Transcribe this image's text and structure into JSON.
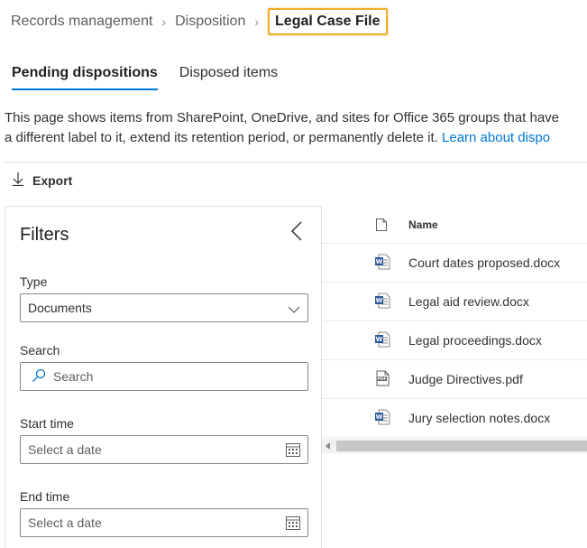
{
  "breadcrumb": {
    "items": [
      "Records management",
      "Disposition"
    ],
    "current": "Legal Case File"
  },
  "tabs": {
    "pending": "Pending dispositions",
    "disposed": "Disposed items"
  },
  "description": {
    "line1": "This page shows items from SharePoint, OneDrive, and sites for Office 365 groups that have",
    "line2": "a different label to it, extend its retention period, or permanently delete it. ",
    "link": "Learn about dispo"
  },
  "toolbar": {
    "export_label": "Export"
  },
  "filters": {
    "title": "Filters",
    "type_label": "Type",
    "type_value": "Documents",
    "search_label": "Search",
    "search_placeholder": "Search",
    "start_label": "Start time",
    "start_placeholder": "Select a date",
    "end_label": "End time",
    "end_placeholder": "Select a date"
  },
  "table": {
    "header_name": "Name",
    "rows": [
      {
        "name": "Court dates proposed.docx",
        "icon": "word-doc-icon"
      },
      {
        "name": "Legal aid review.docx",
        "icon": "word-doc-icon"
      },
      {
        "name": "Legal proceedings.docx",
        "icon": "word-doc-icon"
      },
      {
        "name": "Judge Directives.pdf",
        "icon": "pdf-icon"
      },
      {
        "name": "Jury selection notes.docx",
        "icon": "word-doc-icon"
      }
    ]
  },
  "colors": {
    "accent": "#0078d4",
    "highlight": "#f0ad28",
    "word": "#2b579a"
  }
}
